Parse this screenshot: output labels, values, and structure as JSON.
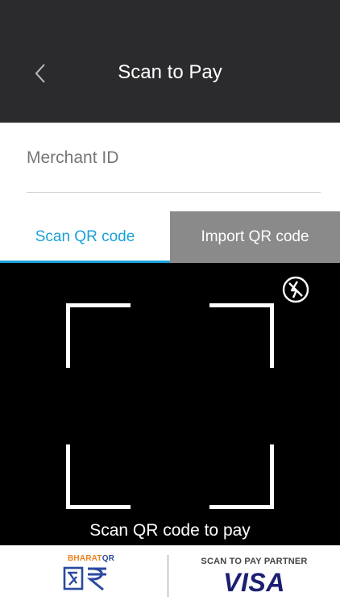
{
  "header": {
    "title": "Scan to Pay",
    "back_icon": "chevron-left-icon"
  },
  "merchant": {
    "placeholder": "Merchant ID",
    "value": ""
  },
  "tabs": [
    {
      "label": "Scan QR code",
      "active": true
    },
    {
      "label": "Import QR code",
      "active": false
    }
  ],
  "scanner": {
    "caption": "Scan QR code to pay",
    "flash_icon": "flash-off-icon"
  },
  "footer": {
    "bharat_qr": {
      "label_part1": "BHARAT",
      "label_part2": "QR"
    },
    "partner_label": "SCAN TO PAY PARTNER",
    "visa_label": "VISA"
  },
  "colors": {
    "header_bg": "#2b2b2d",
    "accent": "#1aa0d8",
    "inactive_tab_bg": "#8a8a8a",
    "camera_bg": "#000000",
    "visa_blue": "#1a1f71",
    "bharat_orange": "#e8801e"
  }
}
